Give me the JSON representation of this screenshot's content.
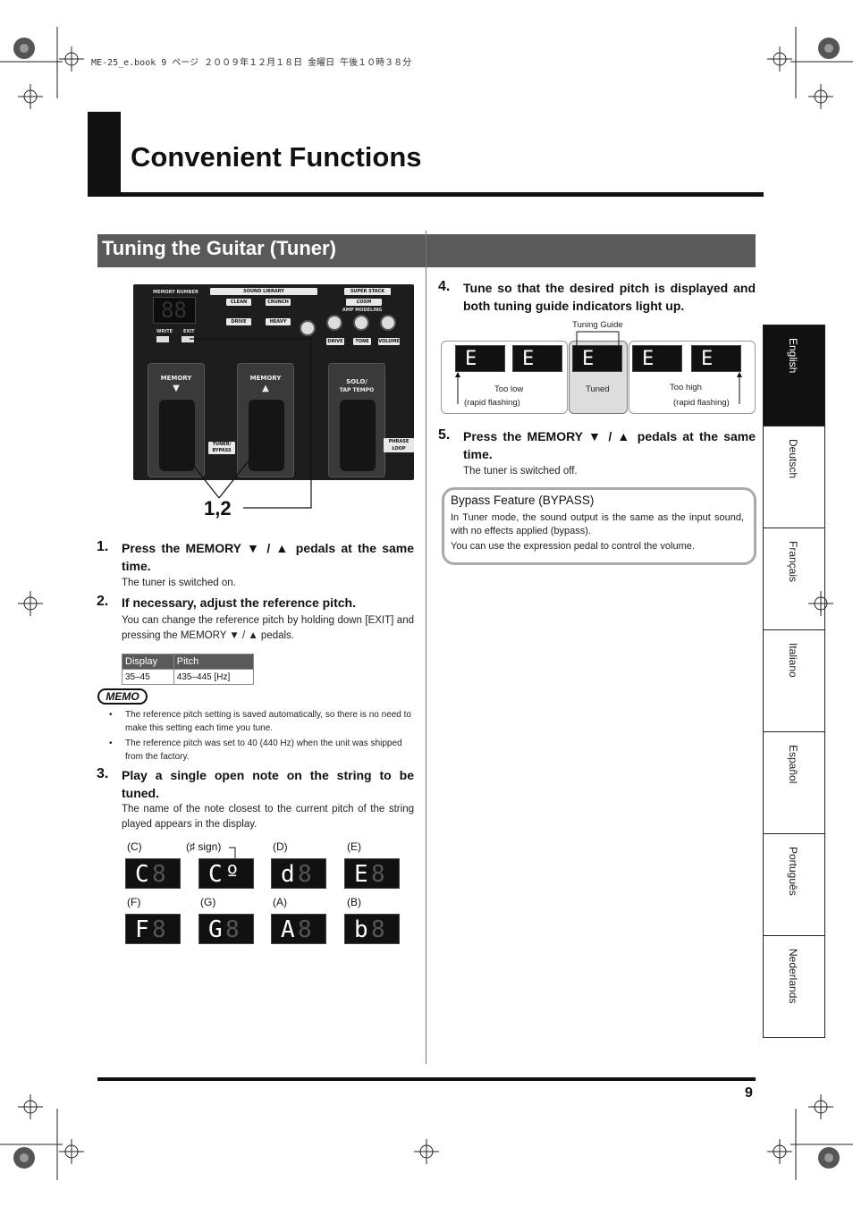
{
  "header": {
    "file_info": "ME-25_e.book  9 ページ  ２００９年１２月１８日  金曜日  午後１０時３８分"
  },
  "title": "Convenient Functions",
  "section": {
    "title": "Tuning the Guitar (Tuner)"
  },
  "device": {
    "memory_number": "MEMORY NUMBER",
    "sound_library": "SOUND LIBRARY",
    "super_stack": "SUPER STACK",
    "clean": "CLEAN",
    "crunch": "CRUNCH",
    "drive": "DRIVE",
    "heavy": "HEAVY",
    "amp_modeling": "AMP MODELING",
    "cosm": "COSM",
    "write": "WRITE",
    "exit": "EXIT",
    "knob_drive": "DRIVE",
    "knob_tone": "TONE",
    "knob_volume": "VOLUME",
    "pedal_memory_down": "MEMORY",
    "pedal_memory_up": "MEMORY",
    "pedal_solo": "SOLO/",
    "pedal_tap": "TAP TEMPO",
    "tuner_bypass": "TUNER/ BYPASS",
    "phrase_loop": "PHRASE LOOP",
    "callout": "1,2"
  },
  "steps": {
    "s1": {
      "num": "1.",
      "heading": "Press the MEMORY ▼ / ▲ pedals at the same time.",
      "body": "The tuner is switched on."
    },
    "s2": {
      "num": "2.",
      "heading": "If necessary, adjust the reference pitch.",
      "body": "You can change the reference pitch by holding down [EXIT] and pressing the MEMORY ▼ / ▲ pedals."
    },
    "s3": {
      "num": "3.",
      "heading": "Play a single open note on the string to be tuned.",
      "body": "The name of the note closest to the current pitch of the string played appears in the display."
    },
    "s4": {
      "num": "4.",
      "heading": "Tune so that the desired pitch is displayed and both tuning guide indicators light up."
    },
    "s5": {
      "num": "5.",
      "heading": "Press the MEMORY ▼ / ▲ pedals at the same time.",
      "body": "The tuner is switched off."
    }
  },
  "pitch_table": {
    "headers": [
      "Display",
      "Pitch"
    ],
    "rows": [
      [
        "35–45",
        "435–445 [Hz]"
      ]
    ]
  },
  "memo": {
    "label": "MEMO",
    "items": [
      "The reference pitch setting is saved automatically, so there is no need to make this setting each time you tune.",
      "The reference pitch was set to 40 (440 Hz) when the unit was shipped from the factory."
    ]
  },
  "notes": [
    {
      "caption": "(C)",
      "char": "C"
    },
    {
      "caption": "(♯ sign)",
      "char": "C"
    },
    {
      "caption": "(D)",
      "char": "d"
    },
    {
      "caption": "(E)",
      "char": "E"
    },
    {
      "caption": "(F)",
      "char": "F"
    },
    {
      "caption": "(G)",
      "char": "G"
    },
    {
      "caption": "(A)",
      "char": "A"
    },
    {
      "caption": "(B)",
      "char": "b"
    }
  ],
  "tuner_display": {
    "guide": "Tuning Guide",
    "too_low": "Too low",
    "too_low_sub": "(rapid flashing)",
    "tuned": "Tuned",
    "too_high": "Too high",
    "too_high_sub": "(rapid flashing)",
    "char": "E"
  },
  "bypass": {
    "title": "Bypass Feature (BYPASS)",
    "line1": "In Tuner mode, the sound output is the same as the input sound, with no effects applied (bypass).",
    "line2": "You can use the expression pedal to control the volume."
  },
  "languages": [
    "English",
    "Deutsch",
    "Français",
    "Italiano",
    "Español",
    "Português",
    "Nederlands"
  ],
  "page_number": "9"
}
